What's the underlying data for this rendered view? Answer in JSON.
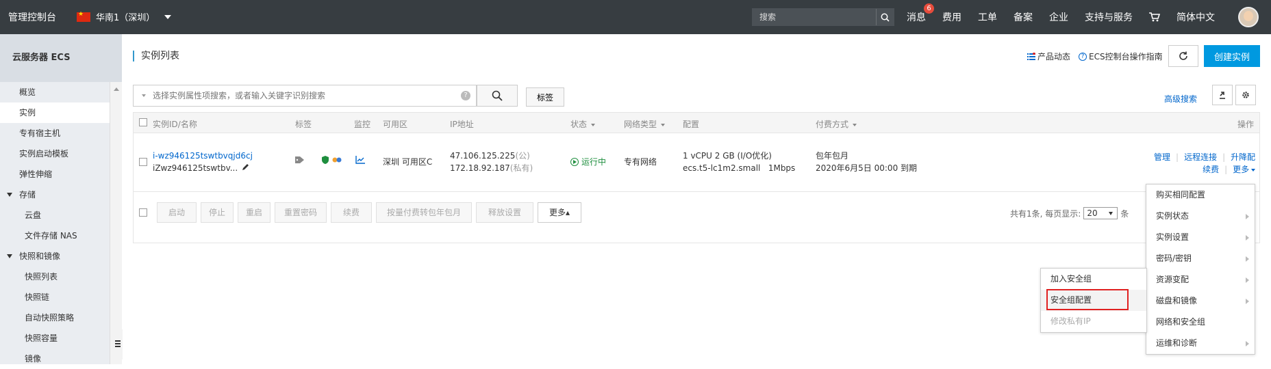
{
  "topbar": {
    "brand": "管理控制台",
    "region": "华南1（深圳）",
    "search_placeholder": "搜索",
    "nav": [
      {
        "label": "消息",
        "badge": "6"
      },
      {
        "label": "费用"
      },
      {
        "label": "工单"
      },
      {
        "label": "备案"
      },
      {
        "label": "企业"
      },
      {
        "label": "支持与服务"
      }
    ],
    "language": "简体中文"
  },
  "sidebar": {
    "title": "云服务器 ECS",
    "items": [
      {
        "label": "概览"
      },
      {
        "label": "实例"
      },
      {
        "label": "专有宿主机"
      },
      {
        "label": "实例启动模板"
      },
      {
        "label": "弹性伸缩"
      },
      {
        "label": "存储"
      },
      {
        "label": "云盘"
      },
      {
        "label": "文件存储 NAS"
      },
      {
        "label": "快照和镜像"
      },
      {
        "label": "快照列表"
      },
      {
        "label": "快照链"
      },
      {
        "label": "自动快照策略"
      },
      {
        "label": "快照容量"
      },
      {
        "label": "镜像"
      }
    ]
  },
  "main": {
    "title": "实例列表",
    "product_news": "产品动态",
    "guide": "ECS控制台操作指南",
    "create_button": "创建实例",
    "filter_placeholder": "选择实例属性项搜索，或者输入关键字识别搜索",
    "tag_button": "标签",
    "advanced_search": "高级搜索"
  },
  "table": {
    "headers": {
      "id": "实例ID/名称",
      "tags": "标签",
      "monitor": "监控",
      "zone": "可用区",
      "ip": "IP地址",
      "status": "状态",
      "network": "网络类型",
      "config": "配置",
      "billing": "付费方式",
      "actions": "操作"
    },
    "row": {
      "id": "i-wz946125tswtbvqjd6cj",
      "name": "iZwz946125tswtbv...",
      "zone": "深圳 可用区C",
      "ip_public": "47.106.125.225",
      "ip_public_suffix": "(公)",
      "ip_private": "172.18.92.187",
      "ip_private_suffix": "(私有)",
      "status": "运行中",
      "network": "专有网络",
      "config_line1": "1 vCPU 2 GB (I/O优化)",
      "config_line2": "ecs.t5-lc1m2.small   1Mbps",
      "billing_line1": "包年包月",
      "billing_line2": "2020年6月5日 00:00 到期",
      "actions": {
        "manage": "管理",
        "remote": "远程连接",
        "upgrade": "升降配",
        "renew": "续费",
        "more": "更多"
      }
    },
    "footer_buttons": [
      "启动",
      "停止",
      "重启",
      "重置密码",
      "续费",
      "按量付费转包年包月",
      "释放设置",
      "更多▴"
    ],
    "pager": {
      "text": "共有1条, 每页显示:",
      "size": "20",
      "unit": "条"
    }
  },
  "more_menu": [
    {
      "label": "购买相同配置",
      "sub": false
    },
    {
      "label": "实例状态",
      "sub": true
    },
    {
      "label": "实例设置",
      "sub": true
    },
    {
      "label": "密码/密钥",
      "sub": true
    },
    {
      "label": "资源变配",
      "sub": true
    },
    {
      "label": "磁盘和镜像",
      "sub": true
    },
    {
      "label": "网络和安全组",
      "sub": false
    },
    {
      "label": "运维和诊断",
      "sub": true
    }
  ],
  "sub_menu": [
    {
      "label": "加入安全组"
    },
    {
      "label": "安全组配置"
    },
    {
      "label": "修改私有IP"
    }
  ],
  "colors": {
    "topbar_bg": "#373d41",
    "accent": "#0099e0",
    "link": "#0066cc",
    "running": "#1e8e3e",
    "highlight_box": "#e02020"
  }
}
